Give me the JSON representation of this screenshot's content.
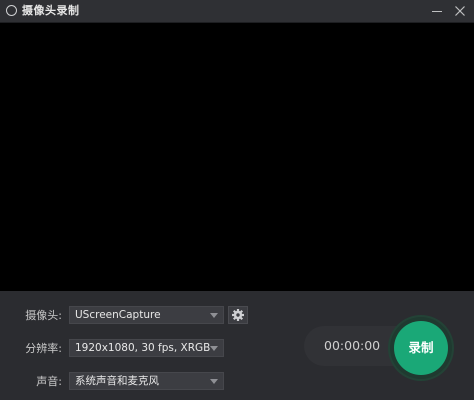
{
  "window": {
    "title": "摄像头录制"
  },
  "controls": {
    "camera": {
      "label": "摄像头:",
      "value": "UScreenCapture"
    },
    "resolution": {
      "label": "分辨率:",
      "value": "1920x1080, 30 fps, XRGB"
    },
    "audio": {
      "label": "声音:",
      "value": "系统声音和麦克风"
    }
  },
  "recorder": {
    "timer": "00:00:00",
    "record_label": "录制"
  },
  "colors": {
    "record_button": "#1aa877",
    "preview_bg": "#000000",
    "panel_bg": "#2b2c30"
  },
  "icons": [
    "app-ring-icon",
    "minimize-icon",
    "close-icon",
    "gear-icon",
    "dropdown-caret-icon"
  ]
}
